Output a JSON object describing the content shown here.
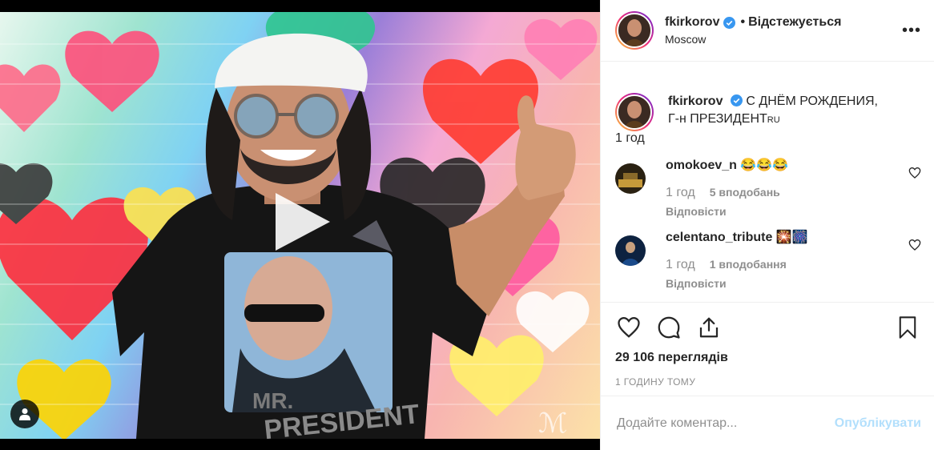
{
  "header": {
    "username": "fkirkorov",
    "separator": "•",
    "follow_state": "Відстежується",
    "location": "Moscow",
    "more": "•••"
  },
  "caption": {
    "username": "fkirkorov",
    "text_line1": "С ДНЁМ РОЖДЕНИЯ,",
    "text_line2": "Г-н ПРЕЗИДЕНТ",
    "flag": "RU",
    "time": "1 год"
  },
  "comments": [
    {
      "username": "omokoev_n",
      "text": "😂😂😂",
      "time": "1 год",
      "likes": "5 вподобань",
      "reply": "Відповісти"
    },
    {
      "username": "celentano_tribute",
      "text": "🎇🎆",
      "time": "1 год",
      "likes": "1 вподобання",
      "reply": "Відповісти"
    }
  ],
  "stats": {
    "views": "29 106 переглядів",
    "timestamp": "1 ГОДИНУ ТОМУ"
  },
  "add_comment": {
    "placeholder": "Додайте коментар...",
    "publish": "Опублікувати"
  },
  "media": {
    "shirt_text_line1": "MR.",
    "shirt_text_line2": "PRESIDENT",
    "watermark": "ℳ"
  },
  "colors": {
    "verified": "#3897f0",
    "muted_text": "#8e8e8e",
    "publish_disabled": "#b2dffc",
    "divider": "#efefef"
  },
  "icons": {
    "like": "heart-icon",
    "comment": "comment-bubble-icon",
    "share": "share-icon",
    "save": "bookmark-icon",
    "play": "play-icon",
    "user_tag": "user-tag-icon",
    "more": "more-options-icon"
  }
}
